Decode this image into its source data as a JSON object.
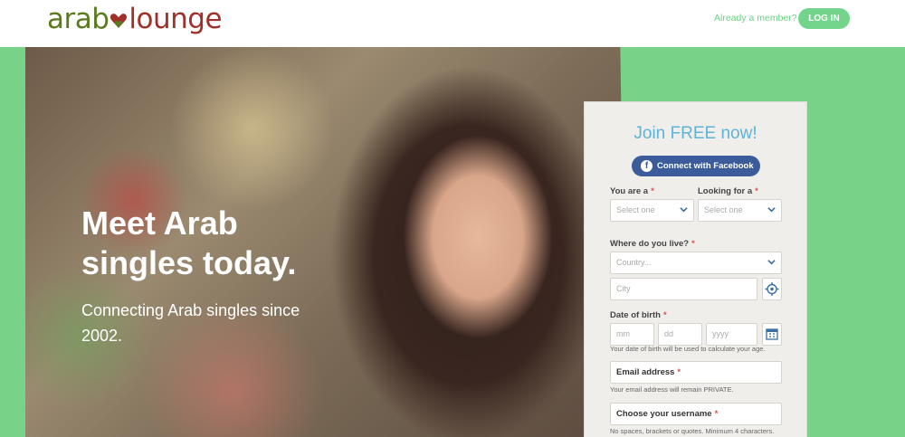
{
  "header": {
    "logo_part1": "arab",
    "logo_part2": "lounge",
    "already_member": "Already a member?",
    "login_label": "LOG IN"
  },
  "hero": {
    "headline": "Meet Arab singles today.",
    "subheadline": "Connecting Arab singles since 2002."
  },
  "form": {
    "title": "Join FREE now!",
    "facebook_label": "Connect with Facebook",
    "you_are_label": "You are a",
    "you_are_value": "Select one",
    "looking_for_label": "Looking for a",
    "looking_for_value": "Select one",
    "where_label": "Where do you live?",
    "country_placeholder": "Country...",
    "city_placeholder": "City",
    "dob_label": "Date of birth",
    "dob_mm": "mm",
    "dob_dd": "dd",
    "dob_yyyy": "yyyy",
    "dob_help": "Your date of birth will be used to calculate your age.",
    "email_label": "Email address",
    "email_help": "Your email address will remain PRIVATE.",
    "username_label": "Choose your username",
    "username_help": "No spaces, brackets or quotes. Minimum 4 characters.",
    "required_mark": "*"
  },
  "colors": {
    "brand_green": "#78d389",
    "logo_green": "#5a7a1e",
    "logo_red": "#a0312a",
    "facebook_blue": "#3b5b9a",
    "title_blue": "#5fb3d8"
  }
}
